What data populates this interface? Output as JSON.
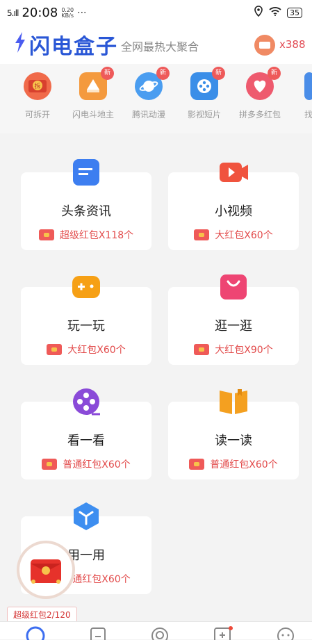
{
  "status": {
    "time": "20:08",
    "signal": "5.ıll",
    "speed_value": "0.20",
    "speed_unit": "KB/s",
    "dots": "···",
    "battery": "35"
  },
  "header": {
    "title": "闪电盒子",
    "subtitle": "全网最热大聚合",
    "coin_count": "x388"
  },
  "top_items": [
    {
      "label": "可拆开",
      "color": "#f06a4a",
      "new": false,
      "glyph": "拆"
    },
    {
      "label": "闪电斗地主",
      "color": "#f49a3e",
      "new": true,
      "glyph": ""
    },
    {
      "label": "腾讯动漫",
      "color": "#4a9df0",
      "new": true,
      "glyph": ""
    },
    {
      "label": "影视短片",
      "color": "#3a8ee8",
      "new": true,
      "glyph": ""
    },
    {
      "label": "拼多多红包",
      "color": "#ee5a6e",
      "new": true,
      "glyph": ""
    },
    {
      "label": "找",
      "color": "#4a8de8",
      "new": false,
      "glyph": ""
    }
  ],
  "badge_new": "新",
  "cards": [
    {
      "title": "头条资讯",
      "reward": "超级红包X118个",
      "icon": "news-icon",
      "color": "#3d7ef0"
    },
    {
      "title": "小视频",
      "reward": "大红包X60个",
      "icon": "video-camera-icon",
      "color": "#f0533e"
    },
    {
      "title": "玩一玩",
      "reward": "大红包X60个",
      "icon": "gamepad-icon",
      "color": "#f6a015"
    },
    {
      "title": "逛一逛",
      "reward": "大红包X90个",
      "icon": "shopping-bag-icon",
      "color": "#ee4573"
    },
    {
      "title": "看一看",
      "reward": "普通红包X60个",
      "icon": "film-reel-icon",
      "color": "#8a4ad8"
    },
    {
      "title": "读一读",
      "reward": "普通红包X60个",
      "icon": "book-icon",
      "color": "#f4a020"
    },
    {
      "title": "用一用",
      "reward": "普通红包X60个",
      "icon": "cube-icon",
      "color": "#3d8ef0"
    }
  ],
  "float_label": "超级红包2/120",
  "tabs": [
    {
      "icon": "home-icon",
      "active": true
    },
    {
      "icon": "document-icon",
      "active": false
    },
    {
      "icon": "eye-icon",
      "active": false
    },
    {
      "icon": "video-add-icon",
      "active": false,
      "dot": true
    },
    {
      "icon": "face-icon",
      "active": false
    }
  ]
}
